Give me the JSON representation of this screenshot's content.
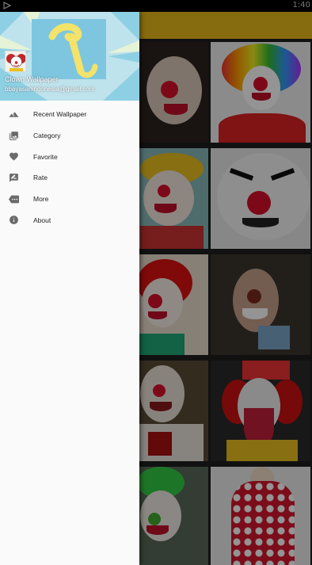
{
  "status_bar": {
    "time": "1:40"
  },
  "drawer": {
    "header": {
      "app_name": "Clown Wallpaper",
      "email": "bbayasanindonesia@gmail.com"
    },
    "menu_items": [
      {
        "label": "Recent Wallpaper",
        "icon": "landscape-icon"
      },
      {
        "label": "Category",
        "icon": "photo-library-icon"
      },
      {
        "label": "Favorite",
        "icon": "heart-icon"
      },
      {
        "label": "Rate",
        "icon": "rate-review-icon"
      },
      {
        "label": "More",
        "icon": "more-chat-icon"
      },
      {
        "label": "About",
        "icon": "info-icon"
      }
    ]
  },
  "colors": {
    "toolbar": "#e8b81a",
    "drawer_bg": "#fafafa",
    "icon": "#6b6b6b"
  }
}
